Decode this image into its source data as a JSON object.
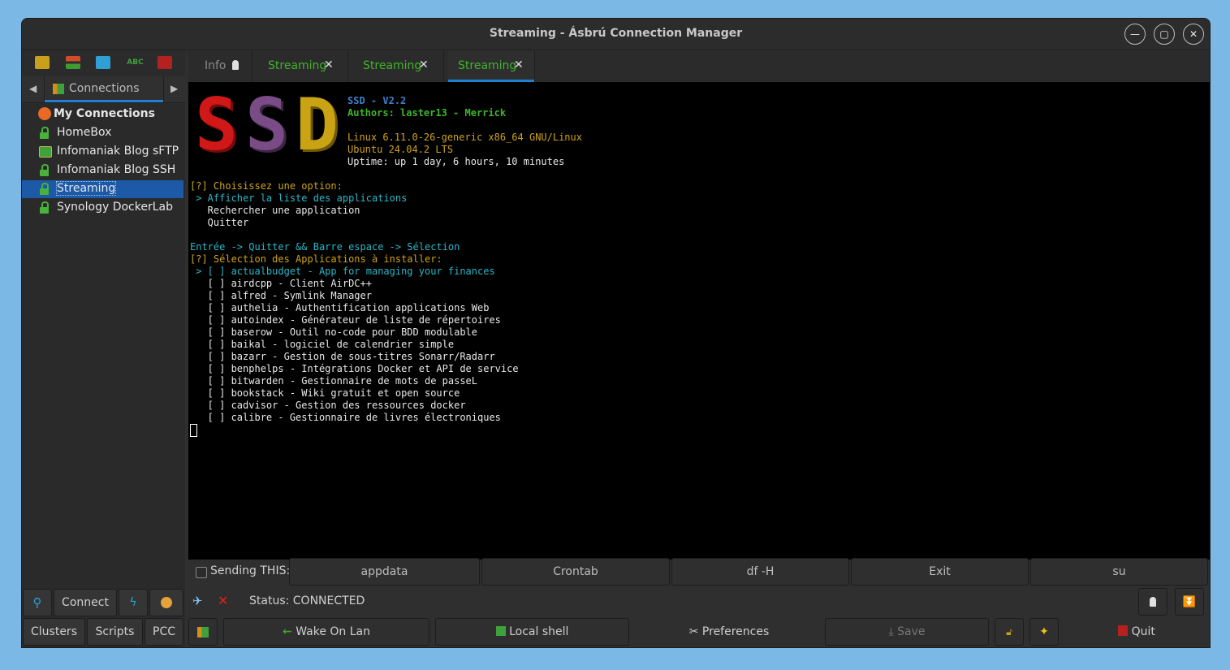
{
  "window": {
    "title": "Streaming  - Ásbrú Connection Manager"
  },
  "sidebar": {
    "tab_label": "Connections",
    "group": "My Connections",
    "items": [
      {
        "label": "HomeBox",
        "icon": "lock-icon"
      },
      {
        "label": "Infomaniak Blog sFTP",
        "icon": "briefcase-icon"
      },
      {
        "label": "Infomaniak Blog SSH",
        "icon": "lock-icon"
      },
      {
        "label": "Streaming",
        "icon": "lock-icon",
        "selected": true
      },
      {
        "label": "Synology DockerLab",
        "icon": "lock-icon"
      }
    ],
    "connect_label": "Connect",
    "clusters_label": "Clusters",
    "scripts_label": "Scripts",
    "pcc_label": "PCC"
  },
  "tabs": [
    {
      "label": "Info",
      "color": "#8a8a8a"
    },
    {
      "label": "Streaming",
      "color": "#3fb52a"
    },
    {
      "label": "Streaming",
      "color": "#3fb52a"
    },
    {
      "label": "Streaming",
      "color": "#3fb52a",
      "active": true
    }
  ],
  "terminal": {
    "ssd_letters": [
      "S",
      "S",
      "D"
    ],
    "ssd_colors": [
      "#d11818",
      "#7a4c86",
      "#c9a314"
    ],
    "header": [
      {
        "text": "SSD - V2.2",
        "color": "#3f7fcf"
      },
      {
        "text": "Authors: laster13 - Merrick",
        "color": "#3fb52a"
      },
      {
        "text": "",
        "color": "#ffffff"
      },
      {
        "text": "Linux 6.11.0-26-generic x86_64 GNU/Linux",
        "color": "#cfa21a"
      },
      {
        "text": "Ubuntu 24.04.2 LTS",
        "color": "#cfa21a"
      },
      {
        "text": "Uptime: up 1 day, 6 hours, 10 minutes",
        "color": "#e8e8e8"
      }
    ],
    "lines": [
      {
        "text": "[?] Choisissez une option:",
        "color": "#cfa21a"
      },
      {
        "text": " > Afficher la liste des applications",
        "color": "#2ab7c9"
      },
      {
        "text": "   Rechercher une application",
        "color": "#e8e8e8"
      },
      {
        "text": "   Quitter",
        "color": "#e8e8e8"
      },
      {
        "text": "",
        "color": "#e8e8e8"
      },
      {
        "text": "Entrée -> Quitter && Barre espace -> Sélection",
        "color": "#2ab7c9"
      },
      {
        "text": "[?] Sélection des Applications à installer:",
        "color": "#cfa21a"
      },
      {
        "text": " > [ ] actualbudget - App for managing your finances",
        "color": "#2ab7c9"
      },
      {
        "text": "   [ ] airdcpp - Client AirDC++",
        "color": "#e8e8e8"
      },
      {
        "text": "   [ ] alfred - Symlink Manager",
        "color": "#e8e8e8"
      },
      {
        "text": "   [ ] authelia - Authentification applications Web",
        "color": "#e8e8e8"
      },
      {
        "text": "   [ ] autoindex - Générateur de liste de répertoires",
        "color": "#e8e8e8"
      },
      {
        "text": "   [ ] baserow - Outil no-code pour BDD modulable",
        "color": "#e8e8e8"
      },
      {
        "text": "   [ ] baikal - logiciel de calendrier simple",
        "color": "#e8e8e8"
      },
      {
        "text": "   [ ] bazarr - Gestion de sous-titres Sonarr/Radarr",
        "color": "#e8e8e8"
      },
      {
        "text": "   [ ] benphelps - Intégrations Docker et API de service",
        "color": "#e8e8e8"
      },
      {
        "text": "   [ ] bitwarden - Gestionnaire de mots de passeL",
        "color": "#e8e8e8"
      },
      {
        "text": "   [ ] bookstack - Wiki gratuit et open source",
        "color": "#e8e8e8"
      },
      {
        "text": "   [ ] cadvisor - Gestion des ressources docker",
        "color": "#e8e8e8"
      },
      {
        "text": "   [ ] calibre - Gestionnaire de livres électroniques",
        "color": "#e8e8e8"
      }
    ]
  },
  "sendbar": {
    "label": "Sending THIS:",
    "buttons": [
      "appdata",
      "Crontab",
      "df -H",
      "Exit",
      "su"
    ]
  },
  "status": {
    "text": "Status: CONNECTED"
  },
  "bottombar": {
    "wake_on_lan": "Wake On Lan",
    "local_shell": "Local shell",
    "preferences": "Preferences",
    "save": "Save",
    "quit": "Quit"
  }
}
